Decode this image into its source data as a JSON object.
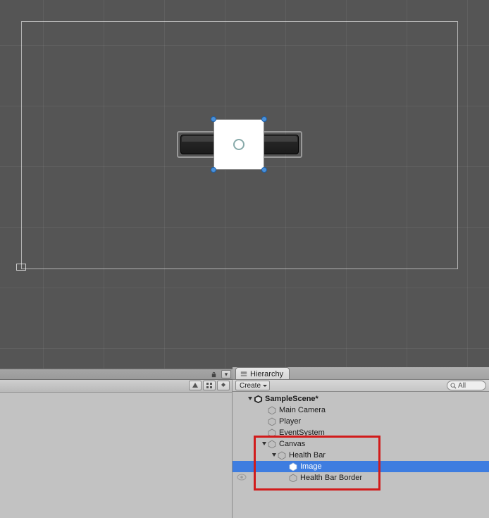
{
  "scene": {
    "selected_object": "Image"
  },
  "hierarchy": {
    "tab_label": "Hierarchy",
    "create_label": "Create",
    "search_placeholder": "All",
    "scene_name": "SampleScene*",
    "items": [
      {
        "label": "Main Camera"
      },
      {
        "label": "Player"
      },
      {
        "label": "EventSystem"
      },
      {
        "label": "Canvas"
      },
      {
        "label": "Health Bar"
      },
      {
        "label": "Image"
      },
      {
        "label": "Health Bar Border"
      }
    ]
  }
}
